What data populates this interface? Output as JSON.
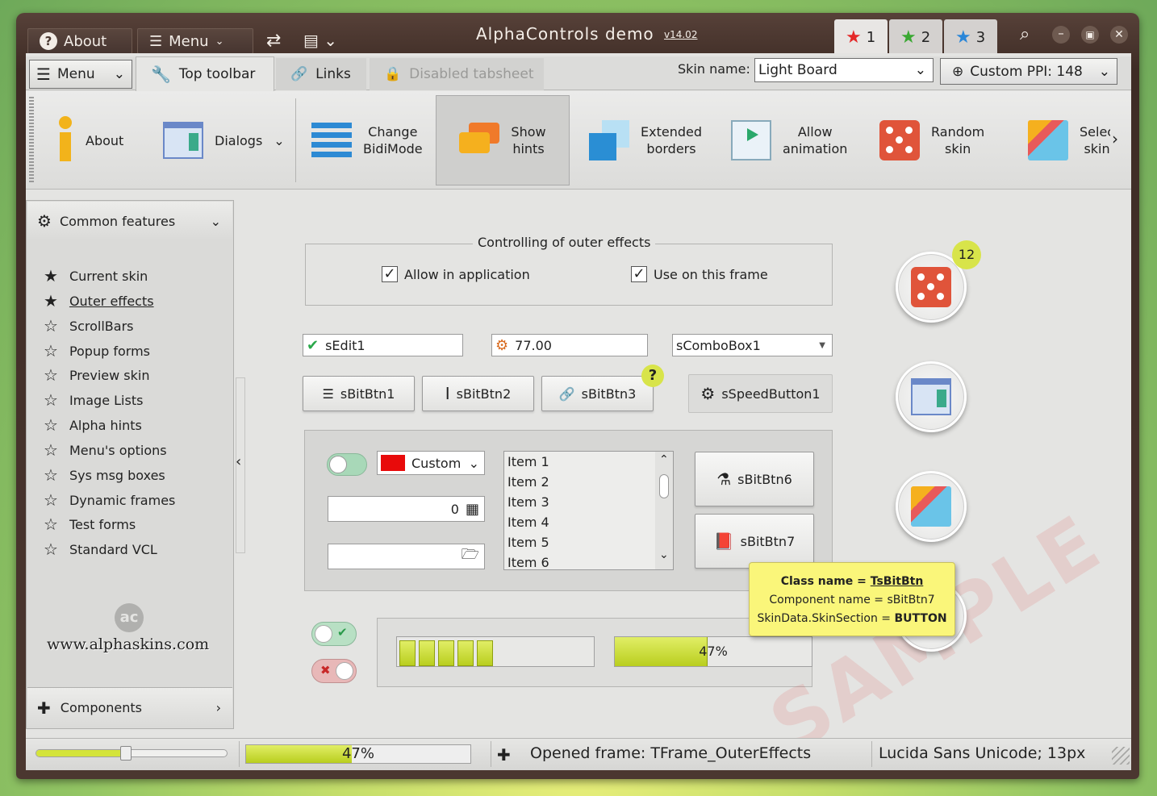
{
  "titlebar": {
    "about": "About",
    "menu": "Menu",
    "title": "AlphaControls demo",
    "version": "v14.02",
    "tabs": [
      "1",
      "2",
      "3"
    ],
    "star_colors": [
      "#e42828",
      "#3aa832",
      "#2a86d8"
    ]
  },
  "tabs": {
    "menu": "Menu",
    "top_toolbar": "Top toolbar",
    "links": "Links",
    "disabled": "Disabled tabsheet"
  },
  "skin": {
    "label": "Skin name:",
    "value": "Light Board",
    "ppi": "Custom PPI: 148"
  },
  "toolbar": {
    "about": "About",
    "dialogs": "Dialogs",
    "bidi": [
      "Change",
      "BidiMode"
    ],
    "hints": [
      "Show",
      "hints"
    ],
    "borders": [
      "Extended",
      "borders"
    ],
    "anim": [
      "Allow",
      "animation"
    ],
    "random": [
      "Random",
      "skin"
    ],
    "select": [
      "Selec",
      "skin"
    ]
  },
  "sidebar": {
    "header": "Common features",
    "items": [
      "Current skin",
      "Outer effects",
      "ScrollBars",
      "Popup forms",
      "Preview skin",
      "Image Lists",
      "Alpha hints",
      "Menu's options",
      "Sys msg boxes",
      "Dynamic frames",
      "Test forms",
      "Standard VCL"
    ],
    "site": "www.alphaskins.com",
    "components": "Components"
  },
  "main": {
    "group_title": "Controlling of outer effects",
    "chk_app": "Allow in application",
    "chk_frame": "Use on this frame",
    "edit1": "sEdit1",
    "edit2": "77.00",
    "combo1": "sComboBox1",
    "btn1": "sBitBtn1",
    "btn2": "sBitBtn2",
    "btn3": "sBitBtn3",
    "speed": "sSpeedButton1",
    "help": "?",
    "color_combo": "Custom",
    "spin_value": "0",
    "list": [
      "Item 1",
      "Item 2",
      "Item 3",
      "Item 4",
      "Item 5",
      "Item 6"
    ],
    "btn6": "sBitBtn6",
    "btn7": "sBitBtn7",
    "badge": "12",
    "progress_label": "47%",
    "progress_value": 0.47,
    "seg_count": 5,
    "watermark": "SAMPLE"
  },
  "hint": {
    "class_label": "Class name = ",
    "class_value": "TsBitBtn",
    "comp": "Component name = sBitBtn7",
    "section_label": "SkinData.SkinSection = ",
    "section_value": "BUTTON"
  },
  "status": {
    "progress": "47%",
    "opened": "Opened frame: TFrame_OuterEffects",
    "font": "Lucida Sans Unicode; 13px",
    "slider_value": 0.47
  }
}
